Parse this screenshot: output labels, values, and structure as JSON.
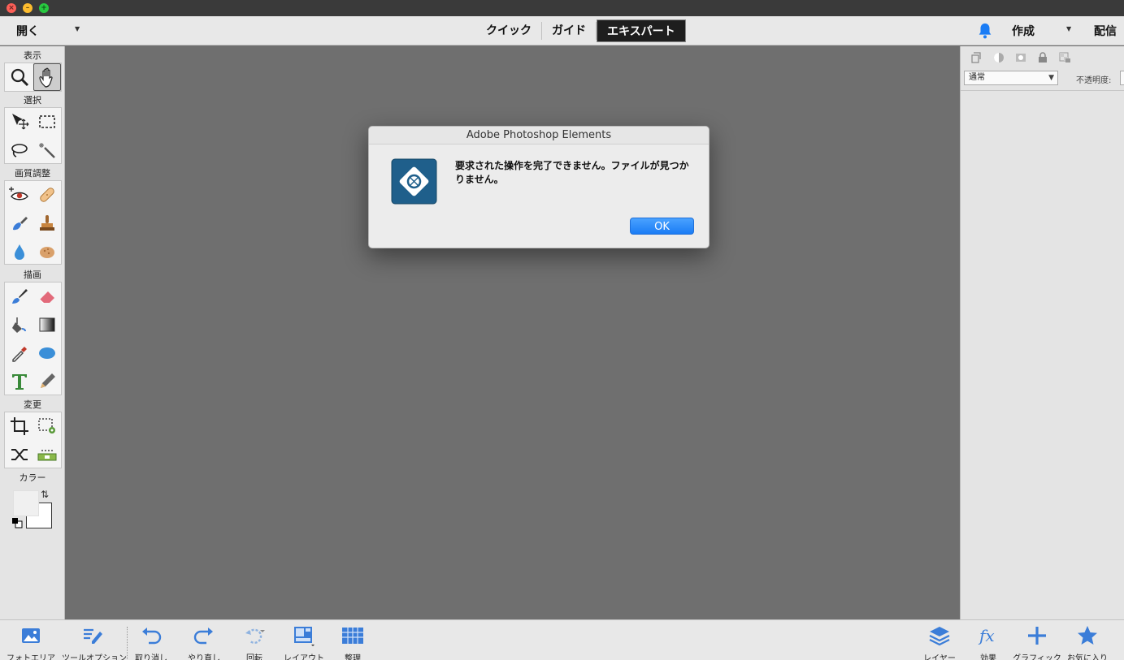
{
  "window": {
    "controls": [
      "close",
      "minimize",
      "maximize"
    ]
  },
  "topbar": {
    "open_label": "開く",
    "modes": [
      {
        "label": "クイック",
        "active": false
      },
      {
        "label": "ガイド",
        "active": false
      },
      {
        "label": "エキスパート",
        "active": true
      }
    ],
    "create_label": "作成",
    "share_label": "配信",
    "bell_icon": "bell-icon",
    "accent_color": "#1a7cf5"
  },
  "toolbox": {
    "sections": {
      "view": "表示",
      "select": "選択",
      "enhance": "画質調整",
      "draw": "描画",
      "modify": "変更",
      "color": "カラー"
    },
    "selected_tool": "hand-tool"
  },
  "rightpanel": {
    "blend_mode": "通常",
    "opacity_label": "不透明度:"
  },
  "bottombar": {
    "items": [
      {
        "label": "フォトエリア"
      },
      {
        "label": "ツールオプション"
      },
      {
        "label": "取り消し"
      },
      {
        "label": "やり直し"
      },
      {
        "label": "回転"
      },
      {
        "label": "レイアウト"
      },
      {
        "label": "整理"
      }
    ],
    "right_items": [
      {
        "label": "レイヤー"
      },
      {
        "label": "効果"
      },
      {
        "label": "グラフィック"
      },
      {
        "label": "お気に入り"
      }
    ]
  },
  "dialog": {
    "title": "Adobe Photoshop Elements",
    "message": "要求された操作を完了できません。ファイルが見つかりません。",
    "ok_label": "OK"
  }
}
